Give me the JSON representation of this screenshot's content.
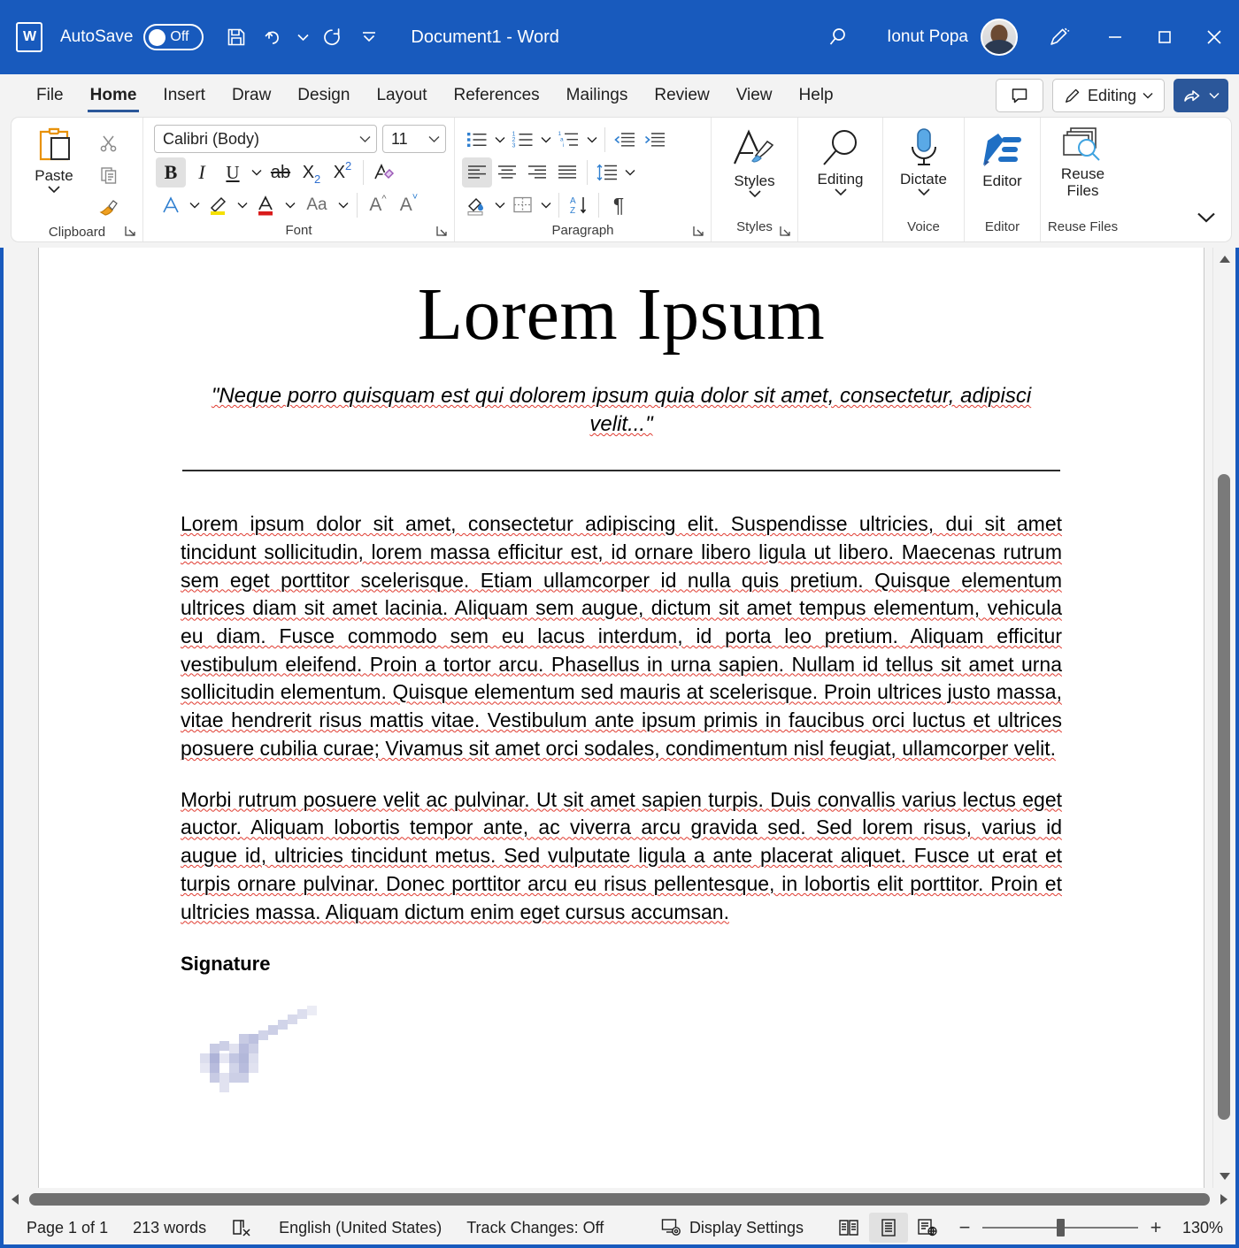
{
  "titlebar": {
    "app_icon": "word-logo-icon",
    "autosave_label": "AutoSave",
    "autosave_state": "Off",
    "save_icon": "save-icon",
    "undo_icon": "undo-icon",
    "redo_icon": "redo-icon",
    "qat_more_icon": "quick-access-more-icon",
    "document_title": "Document1  -  Word",
    "search_icon": "search-icon",
    "user_name": "Ionut Popa",
    "avatar": "user-avatar",
    "ink_icon": "pen-annotate-icon",
    "minimize": "minimize-icon",
    "maximize": "maximize-icon",
    "close": "close-icon"
  },
  "tabs": [
    {
      "label": "File",
      "active": false
    },
    {
      "label": "Home",
      "active": true
    },
    {
      "label": "Insert",
      "active": false
    },
    {
      "label": "Draw",
      "active": false
    },
    {
      "label": "Design",
      "active": false
    },
    {
      "label": "Layout",
      "active": false
    },
    {
      "label": "References",
      "active": false
    },
    {
      "label": "Mailings",
      "active": false
    },
    {
      "label": "Review",
      "active": false
    },
    {
      "label": "View",
      "active": false
    },
    {
      "label": "Help",
      "active": false
    }
  ],
  "tab_right": {
    "comments_icon": "comments-icon",
    "editing_label": "Editing",
    "editing_icon": "pencil-icon",
    "share_icon": "share-icon"
  },
  "ribbon": {
    "clipboard": {
      "group_label": "Clipboard",
      "paste_label": "Paste",
      "paste_icon": "paste-icon",
      "cut_icon": "scissors-icon",
      "copy_icon": "copy-icon",
      "format_painter_icon": "format-painter-icon",
      "dialog_launcher_icon": "dialog-launcher-icon"
    },
    "font": {
      "group_label": "Font",
      "font_name": "Calibri (Body)",
      "font_size": "11",
      "bold_label": "B",
      "italic_label": "I",
      "underline_label": "U",
      "strikethrough_label": "ab",
      "subscript_label": "X",
      "superscript_label": "X",
      "clear_formatting_icon": "clear-formatting-icon",
      "text_effects_icon": "text-effects-icon",
      "highlight_icon": "text-highlight-icon",
      "font_color_icon": "font-color-icon",
      "change_case_label": "Aa",
      "grow_font_label": "A",
      "shrink_font_label": "A",
      "dialog_launcher_icon": "dialog-launcher-icon"
    },
    "paragraph": {
      "group_label": "Paragraph",
      "bullets_icon": "bullets-icon",
      "numbering_icon": "numbering-icon",
      "multilevel_icon": "multilevel-list-icon",
      "decrease_indent_icon": "decrease-indent-icon",
      "increase_indent_icon": "increase-indent-icon",
      "align_left_icon": "align-left-icon",
      "align_center_icon": "align-center-icon",
      "align_right_icon": "align-right-icon",
      "justify_icon": "justify-icon",
      "line_spacing_icon": "line-spacing-icon",
      "shading_icon": "shading-icon",
      "borders_icon": "borders-icon",
      "sort_icon": "sort-icon",
      "show_marks_label": "¶",
      "dialog_launcher_icon": "dialog-launcher-icon"
    },
    "styles": {
      "group_label": "Styles",
      "button_label": "Styles",
      "icon": "styles-icon",
      "dialog_launcher_icon": "dialog-launcher-icon"
    },
    "editing": {
      "button_label": "Editing",
      "icon": "magnifier-icon"
    },
    "voice": {
      "group_label": "Voice",
      "button_label": "Dictate",
      "icon": "microphone-icon"
    },
    "editor": {
      "group_label": "Editor",
      "button_label": "Editor",
      "icon": "editor-pen-icon"
    },
    "reuse": {
      "group_label": "Reuse Files",
      "button_label_line1": "Reuse",
      "button_label_line2": "Files",
      "icon": "reuse-files-icon"
    },
    "collapse_icon": "ribbon-collapse-icon"
  },
  "document": {
    "title": "Lorem Ipsum",
    "subtitle": "\"Neque porro quisquam est qui dolorem ipsum quia dolor sit amet, consectetur, adipisci velit...\"",
    "paragraph1": "Lorem ipsum dolor sit amet, consectetur adipiscing elit. Suspendisse ultricies, dui sit amet tincidunt sollicitudin, lorem massa efficitur est, id ornare libero ligula ut libero. Maecenas rutrum sem eget porttitor scelerisque. Etiam ullamcorper id nulla quis pretium. Quisque elementum ultrices diam sit amet lacinia. Aliquam sem augue, dictum sit amet tempus elementum, vehicula eu diam. Fusce commodo sem eu lacus interdum, id porta leo pretium. Aliquam efficitur vestibulum eleifend. Proin a tortor arcu. Phasellus in urna sapien. Nullam id tellus sit amet urna sollicitudin elementum. Quisque elementum sed mauris at scelerisque. Proin ultrices justo massa, vitae hendrerit risus mattis vitae. Vestibulum ante ipsum primis in faucibus orci luctus et ultrices posuere cubilia curae; Vivamus sit amet orci sodales, condimentum nisl feugiat, ullamcorper velit.",
    "paragraph2": "Morbi rutrum posuere velit ac pulvinar. Ut sit amet sapien turpis. Duis convallis varius lectus eget auctor. Aliquam lobortis tempor ante, ac viverra arcu gravida sed. Sed lorem risus, varius id augue id, ultricies tincidunt metus. Sed vulputate ligula a ante placerat aliquet. Fusce ut erat et turpis ornare pulvinar. Donec porttitor arcu eu risus pellentesque, in lobortis elit porttitor. Proin et ultricies massa. Aliquam dictum enim eget cursus accumsan.",
    "signature_heading": "Signature",
    "signature_image": "handwritten-signature-image"
  },
  "statusbar": {
    "page_info": "Page 1 of 1",
    "word_count": "213 words",
    "proofing_icon": "proofing-errors-icon",
    "language": "English (United States)",
    "track_changes": "Track Changes: Off",
    "display_settings_label": "Display Settings",
    "display_settings_icon": "display-settings-icon",
    "read_mode_icon": "read-mode-icon",
    "print_layout_icon": "print-layout-icon",
    "web_layout_icon": "web-layout-icon",
    "zoom_out_label": "−",
    "zoom_in_label": "+",
    "zoom_level": "130%"
  },
  "colors": {
    "title_bar": "#185abd",
    "accent": "#2b579a",
    "ribbon_bg": "#f3f3f3",
    "page": "#ffffff",
    "spellcheck_red": "#e03b30",
    "grammar_blue": "#2f6fd0"
  }
}
